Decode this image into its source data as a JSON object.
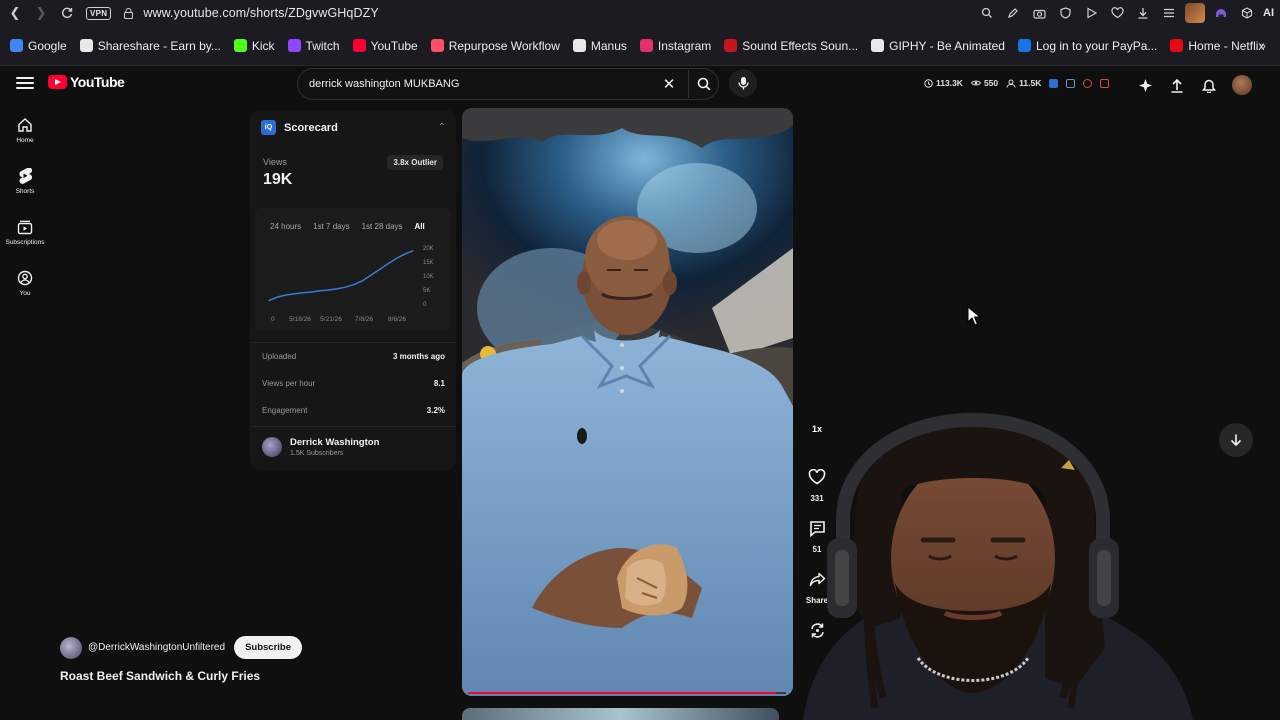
{
  "browser": {
    "url": "www.youtube.com/shorts/ZDgvwGHqDZY",
    "vpn_label": "VPN",
    "ai_label": "AI",
    "bookmarks": [
      {
        "label": "Google",
        "color": "#4285f4"
      },
      {
        "label": "Shareshare - Earn by...",
        "color": "#e8e8e8"
      },
      {
        "label": "Kick",
        "color": "#53fc18"
      },
      {
        "label": "Twitch",
        "color": "#9146ff"
      },
      {
        "label": "YouTube",
        "color": "#ff0033"
      },
      {
        "label": "Repurpose Workflow",
        "color": "#ff4f64"
      },
      {
        "label": "Manus",
        "color": "#e8e8e8"
      },
      {
        "label": "Instagram",
        "color": "#e1306c"
      },
      {
        "label": "Sound Effects Soun...",
        "color": "#c4161c"
      },
      {
        "label": "GIPHY - Be Animated",
        "color": "#e8e8e8"
      },
      {
        "label": "Log in to your PayPa...",
        "color": "#1b74e4"
      },
      {
        "label": "Home - Netflix",
        "color": "#e50914"
      }
    ]
  },
  "header": {
    "logo_text": "YouTube",
    "search_query": "derrick washington MUKBANG",
    "stats": [
      {
        "value": "113.3K",
        "icon": "clock-icon"
      },
      {
        "value": "550",
        "icon": "eye-icon"
      },
      {
        "value": "11.5K",
        "icon": "users-icon"
      }
    ]
  },
  "sidebar": {
    "items": [
      {
        "label": "Home",
        "icon": "home-icon"
      },
      {
        "label": "Shorts",
        "icon": "shorts-icon"
      },
      {
        "label": "Subscriptions",
        "icon": "subscriptions-icon"
      },
      {
        "label": "You",
        "icon": "you-icon"
      }
    ]
  },
  "scorecard": {
    "title": "Scorecard",
    "views_label": "Views",
    "views_value": "19K",
    "outlier_badge": "3.8x Outlier",
    "tabs": [
      {
        "label": "24 hours",
        "active": false
      },
      {
        "label": "1st 7 days",
        "active": false
      },
      {
        "label": "1st 28 days",
        "active": false
      },
      {
        "label": "All",
        "active": true
      }
    ],
    "rows": [
      {
        "key": "Uploaded",
        "value": "3 months ago"
      },
      {
        "key": "Views per hour",
        "value": "8.1"
      },
      {
        "key": "Engagement",
        "value": "3.2%"
      }
    ],
    "channel_name": "Derrick Washington",
    "channel_subs": "1.5K Subscribers"
  },
  "chart_data": {
    "type": "line",
    "x_tick_labels": [
      "0",
      "5/18/26",
      "5/21/26",
      "7/8/26",
      "8/6/26"
    ],
    "y_tick_labels": [
      "0",
      "5K",
      "10K",
      "15K",
      "20K"
    ],
    "ylim": [
      0,
      20000
    ],
    "series_color": "#3a7bd5",
    "x": [
      0,
      1,
      2,
      3,
      4,
      5,
      6,
      7,
      8,
      9,
      10,
      11,
      12,
      13,
      14,
      15,
      16,
      17
    ],
    "values": [
      1200,
      2500,
      3200,
      3600,
      4000,
      4300,
      4700,
      5000,
      5400,
      6000,
      6900,
      8200,
      10200,
      12200,
      14300,
      16200,
      17800,
      19000
    ]
  },
  "rail": {
    "speed_label": "1x",
    "like_count": "331",
    "comment_count": "51",
    "share_label": "Share"
  },
  "video": {
    "progress": 0.97
  },
  "channel": {
    "handle": "@DerrickWashingtonUnfiltered",
    "subscribe_label": "Subscribe",
    "title": "Roast Beef Sandwich & Curly Fries"
  }
}
